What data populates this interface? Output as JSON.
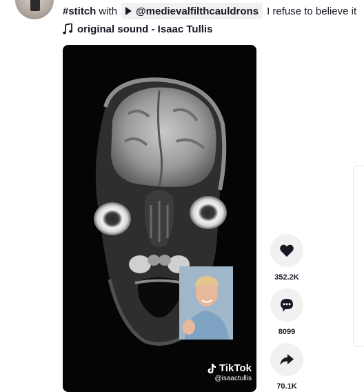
{
  "caption": {
    "hashtag": "#stitch",
    "with_text": "with",
    "mention": "@medievalfilthcauldrons",
    "text": "I refuse to believe it"
  },
  "sound": {
    "label": "original sound - Isaac Tullis"
  },
  "watermark": {
    "brand": "TikTok",
    "handle": "@isaactullis"
  },
  "actions": {
    "like_count": "352.2K",
    "comment_count": "8099",
    "share_count": "70.1K"
  },
  "icons": [
    "play-icon",
    "music-note-icon",
    "heart-icon",
    "comment-icon",
    "share-icon",
    "tiktok-logo-icon"
  ]
}
